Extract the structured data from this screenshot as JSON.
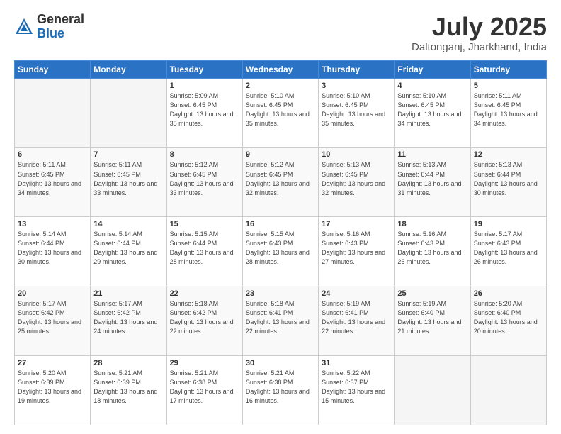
{
  "logo": {
    "general": "General",
    "blue": "Blue"
  },
  "title": "July 2025",
  "location": "Daltonganj, Jharkhand, India",
  "weekdays": [
    "Sunday",
    "Monday",
    "Tuesday",
    "Wednesday",
    "Thursday",
    "Friday",
    "Saturday"
  ],
  "weeks": [
    [
      {
        "day": "",
        "info": ""
      },
      {
        "day": "",
        "info": ""
      },
      {
        "day": "1",
        "info": "Sunrise: 5:09 AM\nSunset: 6:45 PM\nDaylight: 13 hours\nand 35 minutes."
      },
      {
        "day": "2",
        "info": "Sunrise: 5:10 AM\nSunset: 6:45 PM\nDaylight: 13 hours\nand 35 minutes."
      },
      {
        "day": "3",
        "info": "Sunrise: 5:10 AM\nSunset: 6:45 PM\nDaylight: 13 hours\nand 35 minutes."
      },
      {
        "day": "4",
        "info": "Sunrise: 5:10 AM\nSunset: 6:45 PM\nDaylight: 13 hours\nand 34 minutes."
      },
      {
        "day": "5",
        "info": "Sunrise: 5:11 AM\nSunset: 6:45 PM\nDaylight: 13 hours\nand 34 minutes."
      }
    ],
    [
      {
        "day": "6",
        "info": "Sunrise: 5:11 AM\nSunset: 6:45 PM\nDaylight: 13 hours\nand 34 minutes."
      },
      {
        "day": "7",
        "info": "Sunrise: 5:11 AM\nSunset: 6:45 PM\nDaylight: 13 hours\nand 33 minutes."
      },
      {
        "day": "8",
        "info": "Sunrise: 5:12 AM\nSunset: 6:45 PM\nDaylight: 13 hours\nand 33 minutes."
      },
      {
        "day": "9",
        "info": "Sunrise: 5:12 AM\nSunset: 6:45 PM\nDaylight: 13 hours\nand 32 minutes."
      },
      {
        "day": "10",
        "info": "Sunrise: 5:13 AM\nSunset: 6:45 PM\nDaylight: 13 hours\nand 32 minutes."
      },
      {
        "day": "11",
        "info": "Sunrise: 5:13 AM\nSunset: 6:44 PM\nDaylight: 13 hours\nand 31 minutes."
      },
      {
        "day": "12",
        "info": "Sunrise: 5:13 AM\nSunset: 6:44 PM\nDaylight: 13 hours\nand 30 minutes."
      }
    ],
    [
      {
        "day": "13",
        "info": "Sunrise: 5:14 AM\nSunset: 6:44 PM\nDaylight: 13 hours\nand 30 minutes."
      },
      {
        "day": "14",
        "info": "Sunrise: 5:14 AM\nSunset: 6:44 PM\nDaylight: 13 hours\nand 29 minutes."
      },
      {
        "day": "15",
        "info": "Sunrise: 5:15 AM\nSunset: 6:44 PM\nDaylight: 13 hours\nand 28 minutes."
      },
      {
        "day": "16",
        "info": "Sunrise: 5:15 AM\nSunset: 6:43 PM\nDaylight: 13 hours\nand 28 minutes."
      },
      {
        "day": "17",
        "info": "Sunrise: 5:16 AM\nSunset: 6:43 PM\nDaylight: 13 hours\nand 27 minutes."
      },
      {
        "day": "18",
        "info": "Sunrise: 5:16 AM\nSunset: 6:43 PM\nDaylight: 13 hours\nand 26 minutes."
      },
      {
        "day": "19",
        "info": "Sunrise: 5:17 AM\nSunset: 6:43 PM\nDaylight: 13 hours\nand 26 minutes."
      }
    ],
    [
      {
        "day": "20",
        "info": "Sunrise: 5:17 AM\nSunset: 6:42 PM\nDaylight: 13 hours\nand 25 minutes."
      },
      {
        "day": "21",
        "info": "Sunrise: 5:17 AM\nSunset: 6:42 PM\nDaylight: 13 hours\nand 24 minutes."
      },
      {
        "day": "22",
        "info": "Sunrise: 5:18 AM\nSunset: 6:42 PM\nDaylight: 13 hours\nand 22 minutes."
      },
      {
        "day": "23",
        "info": "Sunrise: 5:18 AM\nSunset: 6:41 PM\nDaylight: 13 hours\nand 22 minutes."
      },
      {
        "day": "24",
        "info": "Sunrise: 5:19 AM\nSunset: 6:41 PM\nDaylight: 13 hours\nand 22 minutes."
      },
      {
        "day": "25",
        "info": "Sunrise: 5:19 AM\nSunset: 6:40 PM\nDaylight: 13 hours\nand 21 minutes."
      },
      {
        "day": "26",
        "info": "Sunrise: 5:20 AM\nSunset: 6:40 PM\nDaylight: 13 hours\nand 20 minutes."
      }
    ],
    [
      {
        "day": "27",
        "info": "Sunrise: 5:20 AM\nSunset: 6:39 PM\nDaylight: 13 hours\nand 19 minutes."
      },
      {
        "day": "28",
        "info": "Sunrise: 5:21 AM\nSunset: 6:39 PM\nDaylight: 13 hours\nand 18 minutes."
      },
      {
        "day": "29",
        "info": "Sunrise: 5:21 AM\nSunset: 6:38 PM\nDaylight: 13 hours\nand 17 minutes."
      },
      {
        "day": "30",
        "info": "Sunrise: 5:21 AM\nSunset: 6:38 PM\nDaylight: 13 hours\nand 16 minutes."
      },
      {
        "day": "31",
        "info": "Sunrise: 5:22 AM\nSunset: 6:37 PM\nDaylight: 13 hours\nand 15 minutes."
      },
      {
        "day": "",
        "info": ""
      },
      {
        "day": "",
        "info": ""
      }
    ]
  ]
}
